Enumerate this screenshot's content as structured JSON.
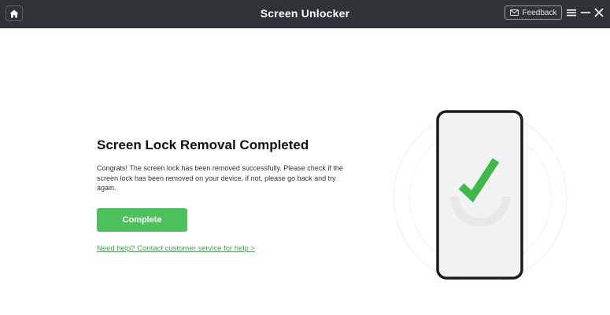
{
  "window": {
    "title": "Screen Unlocker",
    "feedback_label": "Feedback",
    "icons": {
      "home": "home-icon",
      "feedback": "mail-icon",
      "menu": "menu-icon",
      "minimize": "minimize-icon",
      "close": "close-icon"
    }
  },
  "main": {
    "heading": "Screen Lock Removal Completed",
    "description": "Congrats! The screen lock has been removed successfully. Please check if the screen lock has been removed on your device, if not, please go back and try again.",
    "complete_label": "Complete",
    "help_link": "Need help? Contact customer service for help >"
  },
  "colors": {
    "titlebar": "#2f3237",
    "accent": "#4cc05a",
    "link": "#3aa94a",
    "phone_frame": "#1b1b1b",
    "phone_screen": "#f2f2f2"
  }
}
